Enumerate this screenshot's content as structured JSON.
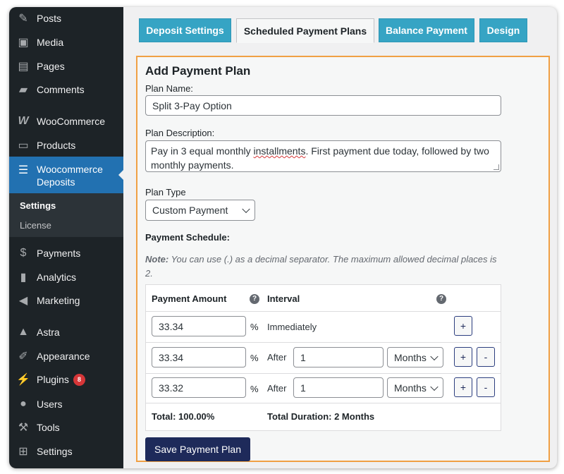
{
  "sidebar": {
    "items": [
      {
        "label": "Posts",
        "icon": "pin-icon"
      },
      {
        "label": "Media",
        "icon": "media-icon"
      },
      {
        "label": "Pages",
        "icon": "pages-icon"
      },
      {
        "label": "Comments",
        "icon": "comment-icon"
      },
      {
        "label": "WooCommerce",
        "icon": "woocommerce-icon"
      },
      {
        "label": "Products",
        "icon": "products-icon"
      },
      {
        "label": "Woocommerce Deposits",
        "icon": "deposits-icon"
      },
      {
        "label": "Payments",
        "icon": "dollar-icon"
      },
      {
        "label": "Analytics",
        "icon": "chart-icon"
      },
      {
        "label": "Marketing",
        "icon": "megaphone-icon"
      },
      {
        "label": "Astra",
        "icon": "astra-icon"
      },
      {
        "label": "Appearance",
        "icon": "brush-icon"
      },
      {
        "label": "Plugins",
        "icon": "plug-icon",
        "badge": "8"
      },
      {
        "label": "Users",
        "icon": "user-icon"
      },
      {
        "label": "Tools",
        "icon": "wrench-icon"
      },
      {
        "label": "Settings",
        "icon": "settings-icon"
      }
    ],
    "submenu": {
      "settings": "Settings",
      "license": "License"
    }
  },
  "tabs": [
    "Deposit Settings",
    "Scheduled Payment Plans",
    "Balance Payment",
    "Design"
  ],
  "form": {
    "title": "Add Payment Plan",
    "plan_name_label": "Plan Name:",
    "plan_name_value": "Split 3-Pay Option",
    "plan_desc_label": "Plan Description:",
    "plan_desc_part1": "Pay in 3 equal monthly ",
    "plan_desc_misspelled": "installments",
    "plan_desc_part2": ". First payment due today, followed by two monthly payments.",
    "plan_type_label": "Plan Type",
    "plan_type_value": "Custom Payment",
    "schedule_label": "Payment Schedule:",
    "note_prefix": "Note:",
    "note_text": " You can use (.) as a decimal separator. The maximum allowed decimal places is 2."
  },
  "schedule": {
    "col_amount": "Payment Amount",
    "col_interval": "Interval",
    "percent_sign": "%",
    "rows": [
      {
        "amount": "33.34",
        "interval_text": "Immediately"
      },
      {
        "amount": "33.34",
        "after": "After",
        "count": "1",
        "unit": "Months"
      },
      {
        "amount": "33.32",
        "after": "After",
        "count": "1",
        "unit": "Months"
      }
    ],
    "total": "Total: 100.00%",
    "total_duration": "Total Duration: 2 Months",
    "plus": "+",
    "minus": "-"
  },
  "save_button": "Save Payment Plan",
  "colors": {
    "accent": "#2271b1",
    "tab": "#36a4c4",
    "panel_border": "#f0a044",
    "primary_button": "#1e2a5a",
    "badge": "#d63638"
  }
}
